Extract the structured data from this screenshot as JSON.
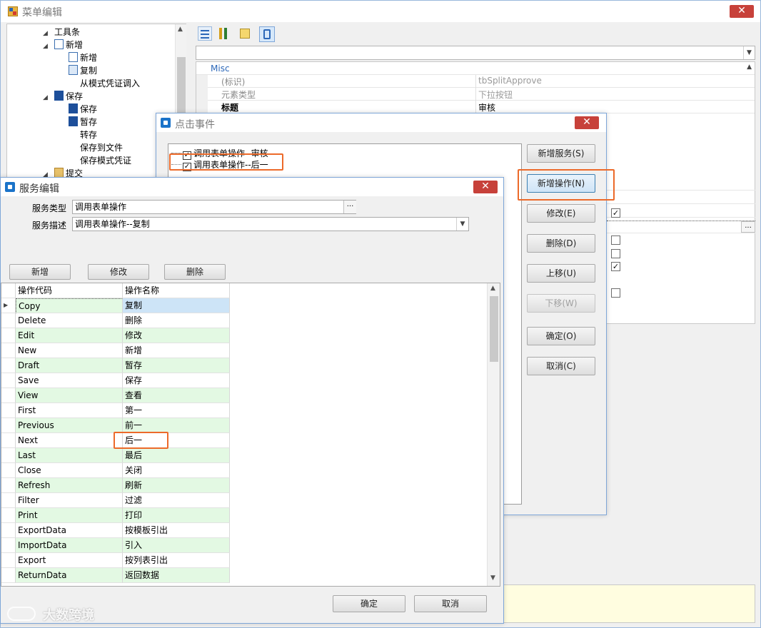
{
  "main_window": {
    "title": "菜单编辑",
    "close_glyph": "✕",
    "tree": [
      {
        "label": "工具条",
        "icon": "none",
        "arrow": "◢"
      },
      {
        "label": "新增",
        "icon": "document-icon",
        "arrow": "◢"
      },
      {
        "label": "新增",
        "icon": "document-icon",
        "arrow": ""
      },
      {
        "label": "复制",
        "icon": "copy-icon",
        "arrow": ""
      },
      {
        "label": "从模式凭证调入",
        "icon": "none",
        "arrow": ""
      },
      {
        "label": "保存",
        "icon": "save-icon",
        "arrow": "◢"
      },
      {
        "label": "保存",
        "icon": "save-icon",
        "arrow": ""
      },
      {
        "label": "暂存",
        "icon": "save-icon",
        "arrow": ""
      },
      {
        "label": "转存",
        "icon": "none",
        "arrow": ""
      },
      {
        "label": "保存到文件",
        "icon": "none",
        "arrow": ""
      },
      {
        "label": "保存模式凭证",
        "icon": "none",
        "arrow": ""
      },
      {
        "label": "提交",
        "icon": "submit-icon",
        "arrow": "◢"
      }
    ],
    "property_grid": {
      "category": "Misc",
      "rows": [
        {
          "name": "(标识)",
          "value": "tbSplitApprove",
          "bold": false
        },
        {
          "name": "元素类型",
          "value": "下拉按钮",
          "bold": false
        },
        {
          "name": "标题",
          "value": "审核",
          "bold": true
        }
      ],
      "ellipsis": "..."
    }
  },
  "click_event_dialog": {
    "title": "点击事件",
    "close_glyph": "✕",
    "items": [
      {
        "label": "调用表单操作--审核",
        "checked": true
      },
      {
        "label": "调用表单操作--后一",
        "checked": true
      }
    ],
    "buttons": {
      "add_service": "新增服务(S)",
      "add_operation": "新增操作(N)",
      "edit": "修改(E)",
      "delete": "删除(D)",
      "move_up": "上移(U)",
      "move_down": "下移(W)",
      "ok": "确定(O)",
      "cancel": "取消(C)"
    }
  },
  "service_dialog": {
    "title": "服务编辑",
    "close_glyph": "✕",
    "service_type_label": "服务类型",
    "service_type_value": "调用表单操作",
    "service_desc_label": "服务描述",
    "service_desc_value": "调用表单操作--复制",
    "ellipsis": "...",
    "buttons": {
      "add": "新增",
      "edit": "修改",
      "delete": "删除",
      "ok": "确定",
      "cancel": "取消"
    },
    "grid": {
      "columns": [
        "操作代码",
        "操作名称"
      ],
      "rows": [
        [
          "Copy",
          "复制"
        ],
        [
          "Delete",
          "删除"
        ],
        [
          "Edit",
          "修改"
        ],
        [
          "New",
          "新增"
        ],
        [
          "Draft",
          "暂存"
        ],
        [
          "Save",
          "保存"
        ],
        [
          "View",
          "查看"
        ],
        [
          "First",
          "第一"
        ],
        [
          "Previous",
          "前一"
        ],
        [
          "Next",
          "后一"
        ],
        [
          "Last",
          "最后"
        ],
        [
          "Close",
          "关闭"
        ],
        [
          "Refresh",
          "刷新"
        ],
        [
          "Filter",
          "过滤"
        ],
        [
          "Print",
          "打印"
        ],
        [
          "ExportData",
          "按模板引出"
        ],
        [
          "ImportData",
          "引入"
        ],
        [
          "Export",
          "按列表引出"
        ],
        [
          "ReturnData",
          "返回数据"
        ]
      ]
    }
  },
  "watermark": "大数跨境",
  "colors": {
    "highlight": "#ec6a2a",
    "row_green": "#e3f9e3",
    "row_selected": "#cde4f7",
    "accent": "#1a73c9"
  }
}
